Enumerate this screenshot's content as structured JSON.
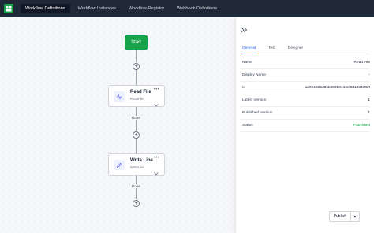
{
  "nav": {
    "items": [
      {
        "label": "Workflow Definitions",
        "active": true
      },
      {
        "label": "Workflow Instances",
        "active": false
      },
      {
        "label": "Workflow Registry",
        "active": false
      },
      {
        "label": "Webhook Definitions",
        "active": false
      }
    ]
  },
  "canvas": {
    "start_label": "Start",
    "nodes": [
      {
        "title": "Read File",
        "subtitle": "ReadFile",
        "icon": "activity-icon",
        "menu": "•••"
      },
      {
        "title": "Write Line",
        "subtitle": "WriteLine",
        "icon": "pencil-icon",
        "menu": "•••"
      }
    ],
    "connectors": [
      {
        "label": "Done"
      },
      {
        "label": "Done"
      }
    ],
    "add_symbol": "+"
  },
  "panel": {
    "tabs": [
      {
        "label": "General",
        "active": true
      },
      {
        "label": "Test",
        "active": false
      },
      {
        "label": "Designer",
        "active": false
      }
    ],
    "properties": [
      {
        "key": "Name",
        "value": "Read File"
      },
      {
        "key": "Display Name",
        "value": "-"
      },
      {
        "key": "Id",
        "value": "ad00e58bc86b482b8144cf8d1334082f"
      },
      {
        "key": "Latest Version",
        "value": "1"
      },
      {
        "key": "Published Version",
        "value": "1"
      },
      {
        "key": "Status",
        "value": "Published"
      }
    ],
    "publish_label": "Publish"
  },
  "colors": {
    "topbar": "#1f2937",
    "start": "#16a34a",
    "accent": "#2563eb",
    "published": "#16a34a"
  }
}
